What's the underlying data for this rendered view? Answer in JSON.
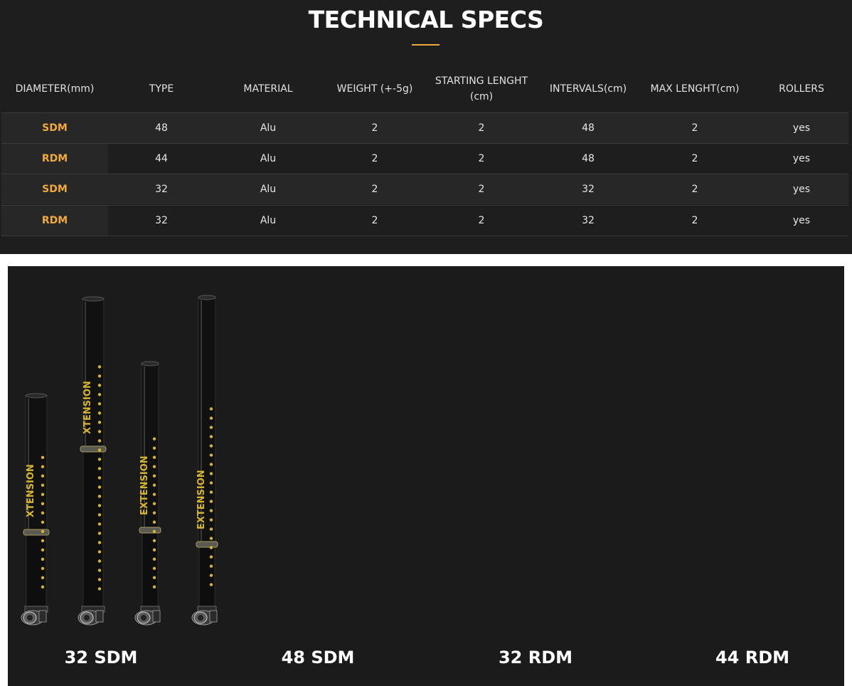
{
  "section_title": "TECHNICAL SPECS",
  "colors": {
    "accent": "#f2a93b",
    "panel_bg": "#1e1e1e",
    "photo_bg": "#1b1b1b",
    "pole_yellow": "#d6b52a"
  },
  "table": {
    "headers": [
      "DIAMETER(mm)",
      "TYPE",
      "MATERIAL",
      "WEIGHT (+-5g)",
      "STARTING LENGHT (cm)",
      "INTERVALS(cm)",
      "MAX LENGHT(cm)",
      "ROLLERS"
    ],
    "rows": [
      [
        "SDM",
        "48",
        "Alu",
        "2",
        "2",
        "48",
        "2",
        "yes"
      ],
      [
        "RDM",
        "44",
        "Alu",
        "2",
        "2",
        "48",
        "2",
        "yes"
      ],
      [
        "SDM",
        "32",
        "Alu",
        "2",
        "2",
        "32",
        "2",
        "yes"
      ],
      [
        "RDM",
        "32",
        "Alu",
        "2",
        "2",
        "32",
        "2",
        "yes"
      ]
    ]
  },
  "products": [
    {
      "label": "32 SDM",
      "pole_text": "XTENSION",
      "icon": "mast-extension-image"
    },
    {
      "label": "48 SDM",
      "pole_text": "XTENSION",
      "icon": "mast-extension-image"
    },
    {
      "label": "32 RDM",
      "pole_text": "EXTENSION",
      "icon": "mast-extension-image"
    },
    {
      "label": "44 RDM",
      "pole_text": "EXTENSION",
      "icon": "mast-extension-image"
    }
  ]
}
